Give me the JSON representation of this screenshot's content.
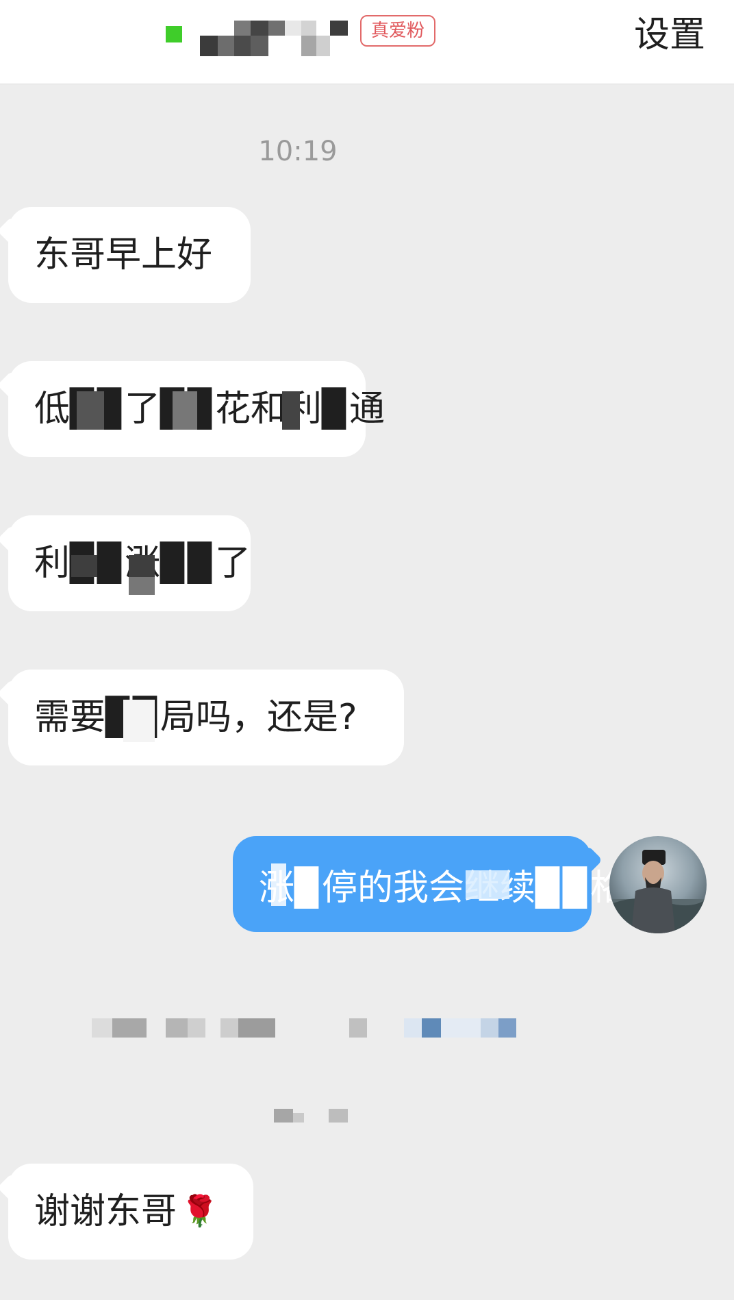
{
  "header": {
    "fan_badge": "真爱粉",
    "settings_label": "设置",
    "online_color": "#3fcd2a"
  },
  "chat": {
    "timestamp": "10:19",
    "incoming": [
      {
        "text": "东哥早上好"
      },
      {
        "text": "低▉▉了▉▉花和利▉通"
      },
      {
        "text": "利▉▉涨▉▉了"
      },
      {
        "text": "需要▉▉局吗，还是?"
      }
    ],
    "outgoing": [
      {
        "text": "涨▉停的我会继续▉▉格"
      }
    ],
    "last_incoming": {
      "text": "谢谢东哥",
      "emoji": "🌹"
    }
  },
  "colors": {
    "background": "#ededed",
    "incoming_bubble": "#ffffff",
    "outgoing_bubble": "#4aa3f8",
    "badge_border": "#e26a6a"
  },
  "icons": {
    "avatar": "avatar-icon"
  }
}
